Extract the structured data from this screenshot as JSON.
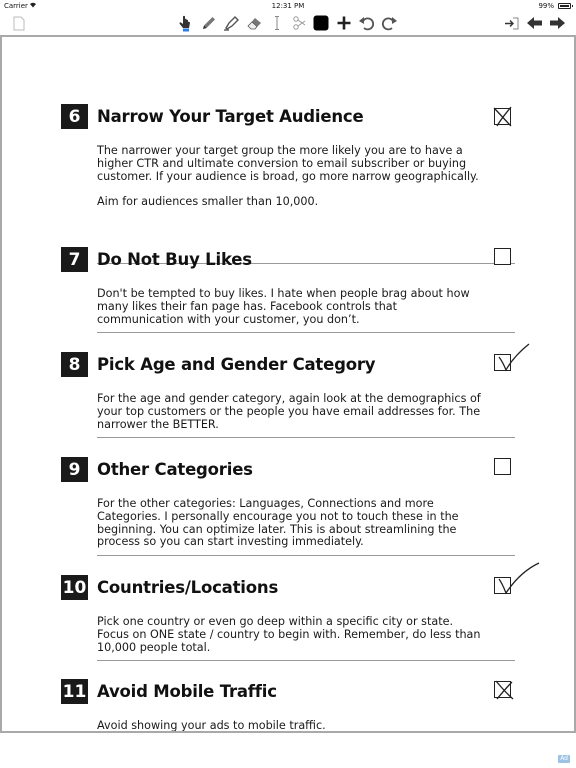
{
  "status_bar": {
    "carrier": "Carrier",
    "time": "12:31 PM",
    "battery": "99%"
  },
  "toolbar": {
    "left_icons": [
      "page-icon"
    ],
    "center_icons": [
      "hand-pointer-icon",
      "pencil-icon",
      "highlighter-icon",
      "eraser-icon",
      "text-cursor-icon",
      "scissors-icon",
      "color-swatch-icon",
      "add-icon",
      "undo-icon",
      "redo-icon"
    ],
    "right_icons": [
      "export-icon",
      "prev-page-icon",
      "next-page-icon"
    ],
    "swatch_color": "#000000"
  },
  "sections": [
    {
      "number": "6",
      "title": "Narrow Your Target Audience",
      "paragraphs": [
        "The narrower your target group the more likely you are to have a higher CTR and ultimate conversion to email subscriber or buying customer. If your audience is broad, go more narrow geographically.",
        "Aim for audiences smaller than 10,000."
      ],
      "checkbox": "crossed"
    },
    {
      "number": "7",
      "title": "Do Not Buy Likes",
      "paragraphs": [
        "Don't be tempted to buy likes. I hate when people brag about how many likes their fan page has. Facebook controls that communication with your customer, you don’t."
      ],
      "checkbox": "empty"
    },
    {
      "number": "8",
      "title": "Pick Age and Gender Category",
      "paragraphs": [
        "For the age and gender category, again look at the demographics of your top customers or the people you have email addresses for. The narrower the BETTER."
      ],
      "checkbox": "checked"
    },
    {
      "number": "9",
      "title": "Other Categories",
      "paragraphs": [
        "For the other categories: Languages, Connections and more Categories. I personally encourage you not to touch these in the beginning. You can optimize later. This is about streamlining the process so you can start investing immediately."
      ],
      "checkbox": "empty"
    },
    {
      "number": "10",
      "title": "Countries/Locations",
      "paragraphs": [
        "Pick one country or even go deep within a specific city or state. Focus on ONE state / country to begin with. Remember, do less than 10,000 people total."
      ],
      "checkbox": "checked"
    },
    {
      "number": "11",
      "title": "Avoid Mobile Traffic",
      "paragraphs": [
        "Avoid showing your ads to mobile traffic."
      ],
      "checkbox": "crossed"
    }
  ],
  "ad_badge": "Ad"
}
